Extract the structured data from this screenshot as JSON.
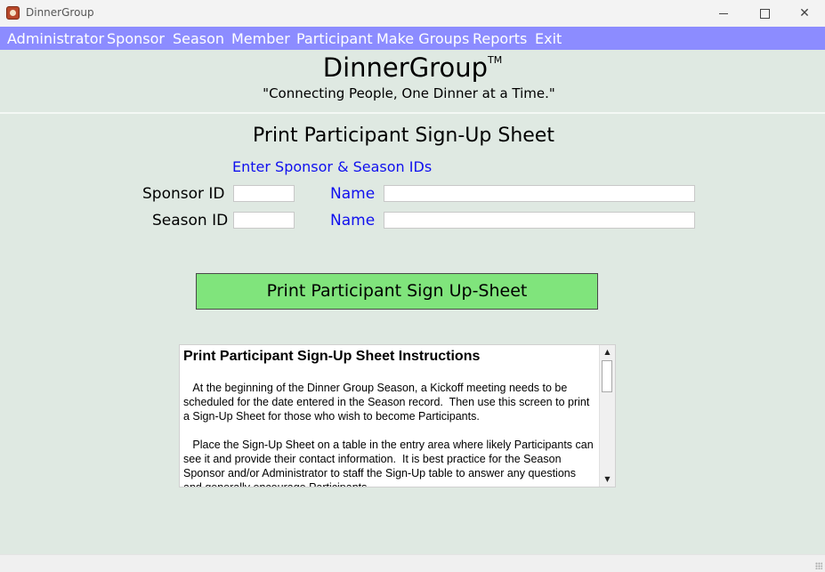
{
  "window": {
    "title": "DinnerGroup"
  },
  "menu": {
    "items": [
      "Administrator",
      "Sponsor",
      "Season",
      "Member",
      "Participant",
      "Make Groups",
      "Reports",
      "Exit"
    ]
  },
  "header": {
    "app_name": "DinnerGroup",
    "trademark": "TM",
    "tagline": "\"Connecting People, One Dinner at a Time.\""
  },
  "form": {
    "page_title": "Print Participant Sign-Up Sheet",
    "hint": "Enter Sponsor & Season IDs",
    "sponsor_id_label": "Sponsor ID",
    "sponsor_id_value": "",
    "sponsor_name_label": "Name",
    "sponsor_name_value": "",
    "season_id_label": "Season ID",
    "season_id_value": "",
    "season_name_label": "Name",
    "season_name_value": "",
    "print_button": "Print Participant Sign Up-Sheet"
  },
  "instructions": {
    "title": "Print Participant Sign-Up Sheet Instructions",
    "paragraphs": [
      "   At the beginning of the Dinner Group Season, a Kickoff meeting needs to be scheduled for the date entered in the Season record.  Then use this screen to print a Sign-Up Sheet for those who wish to become Participants.",
      "   Place the Sign-Up Sheet on a table in the entry area where likely Participants can see it and provide their contact information.  It is best practice for the Season Sponsor and/or Administrator to staff the Sign-Up table to answer any questions and generally encourage Participants."
    ]
  },
  "icons": {
    "app": "dinner-plate-icon",
    "minimize": "minimize-icon",
    "maximize": "maximize-icon",
    "close": "close-icon",
    "scroll_up": "scroll-up-arrow-icon",
    "scroll_down": "scroll-down-arrow-icon"
  },
  "colors": {
    "menubar": "#8c8cff",
    "background": "#dfe9e2",
    "print_button": "#80e47c",
    "blue_label": "#1010ee"
  }
}
